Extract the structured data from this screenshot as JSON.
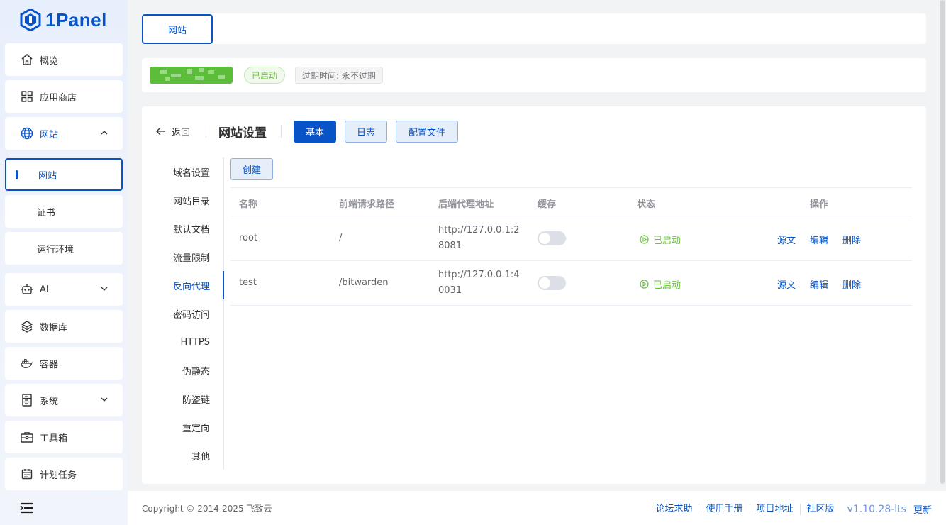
{
  "brand": {
    "name": "1Panel"
  },
  "sidebar": {
    "items": [
      {
        "label": "概览",
        "icon": "home-icon"
      },
      {
        "label": "应用商店",
        "icon": "grid-icon"
      },
      {
        "label": "网站",
        "icon": "globe-icon"
      },
      {
        "label": "AI",
        "icon": "robot-icon"
      },
      {
        "label": "数据库",
        "icon": "layers-icon"
      },
      {
        "label": "容器",
        "icon": "docker-icon"
      },
      {
        "label": "系统",
        "icon": "server-icon"
      },
      {
        "label": "工具箱",
        "icon": "toolbox-icon"
      },
      {
        "label": "计划任务",
        "icon": "calendar-icon"
      }
    ],
    "website_sub": [
      "网站",
      "证书",
      "运行环境"
    ]
  },
  "tabs": {
    "active": "网站"
  },
  "site": {
    "status": "已启动",
    "expire": "过期时间: 永不过期"
  },
  "settings": {
    "back": "返回",
    "title": "网站设置",
    "btn_basic": "基本",
    "btn_log": "日志",
    "btn_config": "配置文件",
    "menu": [
      "域名设置",
      "网站目录",
      "默认文档",
      "流量限制",
      "反向代理",
      "密码访问",
      "HTTPS",
      "伪静态",
      "防盗链",
      "重定向",
      "其他"
    ],
    "active_menu": "反向代理",
    "create": "创建"
  },
  "table": {
    "headers": [
      "名称",
      "前端请求路径",
      "后端代理地址",
      "缓存",
      "状态",
      "操作"
    ],
    "rows": [
      {
        "name": "root",
        "path": "/",
        "backend": "http://127.0.0.1:28081",
        "cache": false,
        "status": "已启动"
      },
      {
        "name": "test",
        "path": "/bitwarden",
        "backend": "http://127.0.0.1:40031",
        "cache": false,
        "status": "已启动"
      }
    ],
    "actions": [
      "源文",
      "编辑",
      "删除"
    ]
  },
  "footer": {
    "copyright": "Copyright © 2014-2025 飞致云",
    "links": [
      "论坛求助",
      "使用手册",
      "项目地址",
      "社区版"
    ],
    "version": "v1.10.28-lts",
    "update": "更新"
  },
  "colors": {
    "accent": "#0854c7",
    "success": "#67c23a",
    "sidebar_bg": "#e8effc"
  }
}
